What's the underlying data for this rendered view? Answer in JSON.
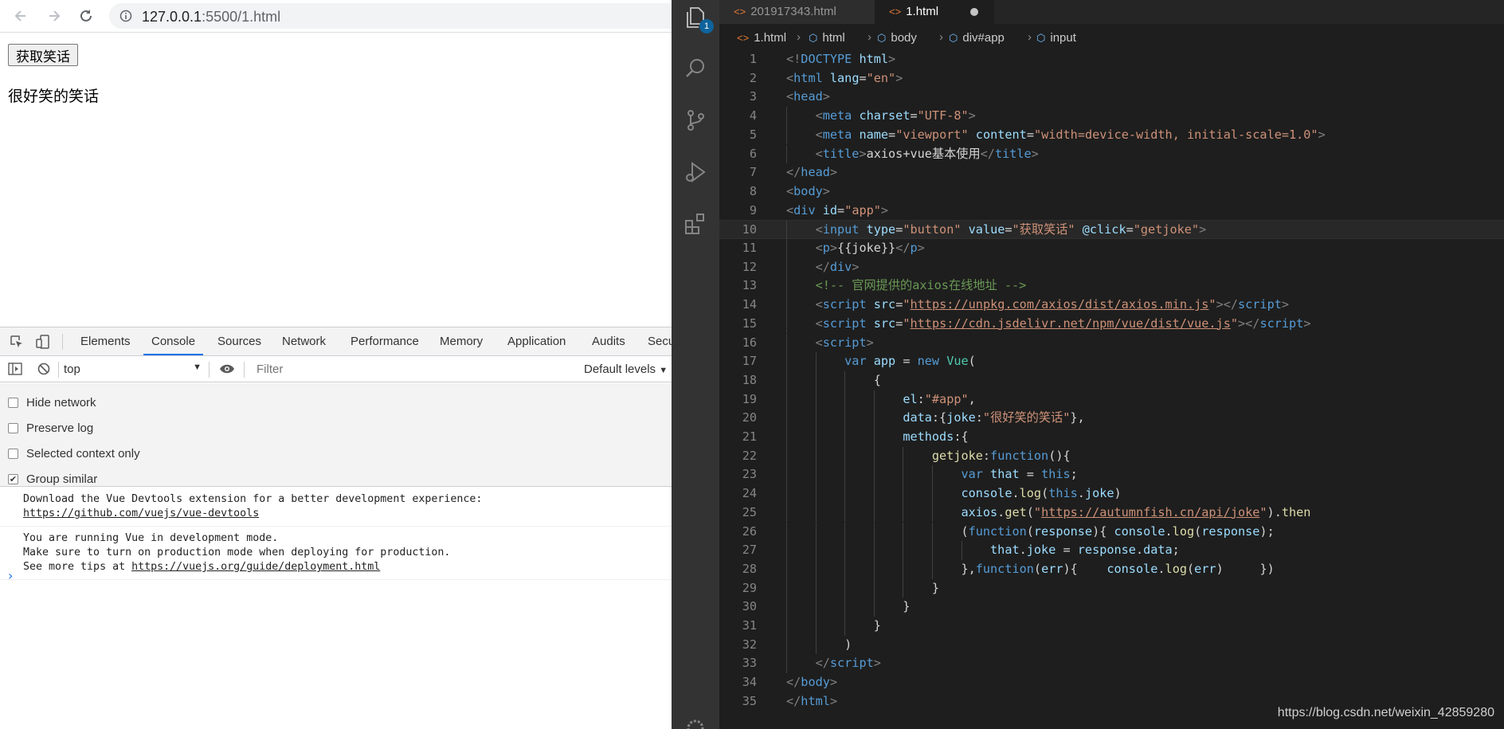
{
  "browser": {
    "url_host": "127.0.0.1",
    "url_rest": ":5500/1.html",
    "page": {
      "button_label": "获取笑话",
      "joke_text": "很好笑的笑话"
    }
  },
  "devtools": {
    "tabs": [
      "Elements",
      "Console",
      "Sources",
      "Network",
      "Performance",
      "Memory",
      "Application",
      "Audits",
      "Secu"
    ],
    "active_tab": "Console",
    "context": "top",
    "filter_placeholder": "Filter",
    "levels": "Default levels",
    "settings": [
      {
        "label": "Hide network",
        "checked": false
      },
      {
        "label": "Preserve log",
        "checked": false
      },
      {
        "label": "Selected context only",
        "checked": false
      },
      {
        "label": "Group similar",
        "checked": true
      }
    ],
    "messages": [
      {
        "text": "Download the Vue Devtools extension for a better development experience:",
        "link": "https://github.com/vuejs/vue-devtools"
      },
      {
        "text": "You are running Vue in development mode.\nMake sure to turn on production mode when deploying for production.\nSee more tips at ",
        "link": "https://vuejs.org/guide/deployment.html"
      }
    ]
  },
  "vscode": {
    "badge": "1",
    "tabs": [
      {
        "label": "201917343.html",
        "active": false
      },
      {
        "label": "1.html",
        "active": true,
        "dirty": true
      }
    ],
    "breadcrumb": [
      "1.html",
      "html",
      "body",
      "div#app",
      "input"
    ],
    "current_line": 10,
    "watermark": "https://blog.csdn.net/weixin_42859280",
    "code_lines": [
      [
        [
          "tg",
          "<!"
        ],
        [
          "tn",
          "DOCTYPE"
        ],
        [
          "tx",
          " "
        ],
        [
          "at",
          "html"
        ],
        [
          "tg",
          ">"
        ]
      ],
      [
        [
          "tg",
          "<"
        ],
        [
          "tn",
          "html"
        ],
        [
          "tx",
          " "
        ],
        [
          "at",
          "lang"
        ],
        [
          "tx",
          "="
        ],
        [
          "st",
          "\"en\""
        ],
        [
          "tg",
          ">"
        ]
      ],
      [
        [
          "tg",
          "<"
        ],
        [
          "tn",
          "head"
        ],
        [
          "tg",
          ">"
        ]
      ],
      [
        [
          "tx",
          "    "
        ],
        [
          "tg",
          "<"
        ],
        [
          "tn",
          "meta"
        ],
        [
          "tx",
          " "
        ],
        [
          "at",
          "charset"
        ],
        [
          "tx",
          "="
        ],
        [
          "st",
          "\"UTF-8\""
        ],
        [
          "tg",
          ">"
        ]
      ],
      [
        [
          "tx",
          "    "
        ],
        [
          "tg",
          "<"
        ],
        [
          "tn",
          "meta"
        ],
        [
          "tx",
          " "
        ],
        [
          "at",
          "name"
        ],
        [
          "tx",
          "="
        ],
        [
          "st",
          "\"viewport\""
        ],
        [
          "tx",
          " "
        ],
        [
          "at",
          "content"
        ],
        [
          "tx",
          "="
        ],
        [
          "st",
          "\"width=device-width, initial-scale=1.0\""
        ],
        [
          "tg",
          ">"
        ]
      ],
      [
        [
          "tx",
          "    "
        ],
        [
          "tg",
          "<"
        ],
        [
          "tn",
          "title"
        ],
        [
          "tg",
          ">"
        ],
        [
          "tx",
          "axios+vue基本使用"
        ],
        [
          "tg",
          "</"
        ],
        [
          "tn",
          "title"
        ],
        [
          "tg",
          ">"
        ]
      ],
      [
        [
          "tg",
          "</"
        ],
        [
          "tn",
          "head"
        ],
        [
          "tg",
          ">"
        ]
      ],
      [
        [
          "tg",
          "<"
        ],
        [
          "tn",
          "body"
        ],
        [
          "tg",
          ">"
        ]
      ],
      [
        [
          "tg",
          "<"
        ],
        [
          "tn",
          "div"
        ],
        [
          "tx",
          " "
        ],
        [
          "at",
          "id"
        ],
        [
          "tx",
          "="
        ],
        [
          "st",
          "\"app\""
        ],
        [
          "tg",
          ">"
        ]
      ],
      [
        [
          "tx",
          "    "
        ],
        [
          "tg",
          "<"
        ],
        [
          "tn",
          "input"
        ],
        [
          "tx",
          " "
        ],
        [
          "at",
          "type"
        ],
        [
          "tx",
          "="
        ],
        [
          "st",
          "\"button\""
        ],
        [
          "tx",
          " "
        ],
        [
          "at",
          "value"
        ],
        [
          "tx",
          "="
        ],
        [
          "st",
          "\"获取笑话\""
        ],
        [
          "tx",
          " "
        ],
        [
          "at",
          "@click"
        ],
        [
          "tx",
          "="
        ],
        [
          "st",
          "\"getjoke\""
        ],
        [
          "tg",
          ">"
        ]
      ],
      [
        [
          "tx",
          "    "
        ],
        [
          "tg",
          "<"
        ],
        [
          "tn",
          "p"
        ],
        [
          "tg",
          ">"
        ],
        [
          "tx",
          "{{joke}}"
        ],
        [
          "tg",
          "</"
        ],
        [
          "tn",
          "p"
        ],
        [
          "tg",
          ">"
        ]
      ],
      [
        [
          "tx",
          "    "
        ],
        [
          "tg",
          "</"
        ],
        [
          "tn",
          "div"
        ],
        [
          "tg",
          ">"
        ]
      ],
      [
        [
          "tx",
          "    "
        ],
        [
          "cm",
          "<!-- 官网提供的axios在线地址 -->"
        ]
      ],
      [
        [
          "tx",
          "    "
        ],
        [
          "tg",
          "<"
        ],
        [
          "tn",
          "script"
        ],
        [
          "tx",
          " "
        ],
        [
          "at",
          "src"
        ],
        [
          "tx",
          "="
        ],
        [
          "st",
          "\""
        ],
        [
          "stu",
          "https://unpkg.com/axios/dist/axios.min.js"
        ],
        [
          "st",
          "\""
        ],
        [
          "tg",
          "></"
        ],
        [
          "tn",
          "script"
        ],
        [
          "tg",
          ">"
        ]
      ],
      [
        [
          "tx",
          "    "
        ],
        [
          "tg",
          "<"
        ],
        [
          "tn",
          "script"
        ],
        [
          "tx",
          " "
        ],
        [
          "at",
          "src"
        ],
        [
          "tx",
          "="
        ],
        [
          "st",
          "\""
        ],
        [
          "stu",
          "https://cdn.jsdelivr.net/npm/vue/dist/vue.js"
        ],
        [
          "st",
          "\""
        ],
        [
          "tg",
          "></"
        ],
        [
          "tn",
          "script"
        ],
        [
          "tg",
          ">"
        ]
      ],
      [
        [
          "tx",
          "    "
        ],
        [
          "tg",
          "<"
        ],
        [
          "tn",
          "script"
        ],
        [
          "tg",
          ">"
        ]
      ],
      [
        [
          "tx",
          "        "
        ],
        [
          "tn",
          "var"
        ],
        [
          "tx",
          " "
        ],
        [
          "vr",
          "app"
        ],
        [
          "tx",
          " = "
        ],
        [
          "tn",
          "new"
        ],
        [
          "tx",
          " "
        ],
        [
          "cl",
          "Vue"
        ],
        [
          "tx",
          "("
        ]
      ],
      [
        [
          "tx",
          "            {"
        ]
      ],
      [
        [
          "tx",
          "                "
        ],
        [
          "vr",
          "el"
        ],
        [
          "tx",
          ":"
        ],
        [
          "st",
          "\"#app\""
        ],
        [
          "tx",
          ","
        ]
      ],
      [
        [
          "tx",
          "                "
        ],
        [
          "vr",
          "data"
        ],
        [
          "tx",
          ":{"
        ],
        [
          "vr",
          "joke"
        ],
        [
          "tx",
          ":"
        ],
        [
          "st",
          "\"很好笑的笑话\""
        ],
        [
          "tx",
          "},"
        ]
      ],
      [
        [
          "tx",
          "                "
        ],
        [
          "vr",
          "methods"
        ],
        [
          "tx",
          ":{"
        ]
      ],
      [
        [
          "tx",
          "                    "
        ],
        [
          "fn",
          "getjoke"
        ],
        [
          "tx",
          ":"
        ],
        [
          "tn",
          "function"
        ],
        [
          "tx",
          "(){"
        ]
      ],
      [
        [
          "tx",
          "                        "
        ],
        [
          "tn",
          "var"
        ],
        [
          "tx",
          " "
        ],
        [
          "vr",
          "that"
        ],
        [
          "tx",
          " = "
        ],
        [
          "tn",
          "this"
        ],
        [
          "tx",
          ";"
        ]
      ],
      [
        [
          "tx",
          "                        "
        ],
        [
          "vr",
          "console"
        ],
        [
          "tx",
          "."
        ],
        [
          "fn",
          "log"
        ],
        [
          "tx",
          "("
        ],
        [
          "tn",
          "this"
        ],
        [
          "tx",
          "."
        ],
        [
          "vr",
          "joke"
        ],
        [
          "tx",
          ")"
        ]
      ],
      [
        [
          "tx",
          "                        "
        ],
        [
          "vr",
          "axios"
        ],
        [
          "tx",
          "."
        ],
        [
          "fn",
          "get"
        ],
        [
          "tx",
          "("
        ],
        [
          "st",
          "\""
        ],
        [
          "stu",
          "https://autumnfish.cn/api/joke"
        ],
        [
          "st",
          "\""
        ],
        [
          "tx",
          ")."
        ],
        [
          "fn",
          "then"
        ]
      ],
      [
        [
          "tx",
          "                        ("
        ],
        [
          "tn",
          "function"
        ],
        [
          "tx",
          "("
        ],
        [
          "vr",
          "response"
        ],
        [
          "tx",
          "){ "
        ],
        [
          "vr",
          "console"
        ],
        [
          "tx",
          "."
        ],
        [
          "fn",
          "log"
        ],
        [
          "tx",
          "("
        ],
        [
          "vr",
          "response"
        ],
        [
          "tx",
          ");"
        ]
      ],
      [
        [
          "tx",
          "                            "
        ],
        [
          "vr",
          "that"
        ],
        [
          "tx",
          "."
        ],
        [
          "vr",
          "joke"
        ],
        [
          "tx",
          " = "
        ],
        [
          "vr",
          "response"
        ],
        [
          "tx",
          "."
        ],
        [
          "vr",
          "data"
        ],
        [
          "tx",
          ";"
        ]
      ],
      [
        [
          "tx",
          "                        },"
        ],
        [
          "tn",
          "function"
        ],
        [
          "tx",
          "("
        ],
        [
          "vr",
          "err"
        ],
        [
          "tx",
          "){    "
        ],
        [
          "vr",
          "console"
        ],
        [
          "tx",
          "."
        ],
        [
          "fn",
          "log"
        ],
        [
          "tx",
          "("
        ],
        [
          "vr",
          "err"
        ],
        [
          "tx",
          ")     })"
        ]
      ],
      [
        [
          "tx",
          "                    }"
        ]
      ],
      [
        [
          "tx",
          "                }"
        ]
      ],
      [
        [
          "tx",
          "            }"
        ]
      ],
      [
        [
          "tx",
          "        )"
        ]
      ],
      [
        [
          "tx",
          "    "
        ],
        [
          "tg",
          "</"
        ],
        [
          "tn",
          "script"
        ],
        [
          "tg",
          ">"
        ]
      ],
      [
        [
          "tg",
          "</"
        ],
        [
          "tn",
          "body"
        ],
        [
          "tg",
          ">"
        ]
      ],
      [
        [
          "tg",
          "</"
        ],
        [
          "tn",
          "html"
        ],
        [
          "tg",
          ">"
        ]
      ]
    ]
  }
}
